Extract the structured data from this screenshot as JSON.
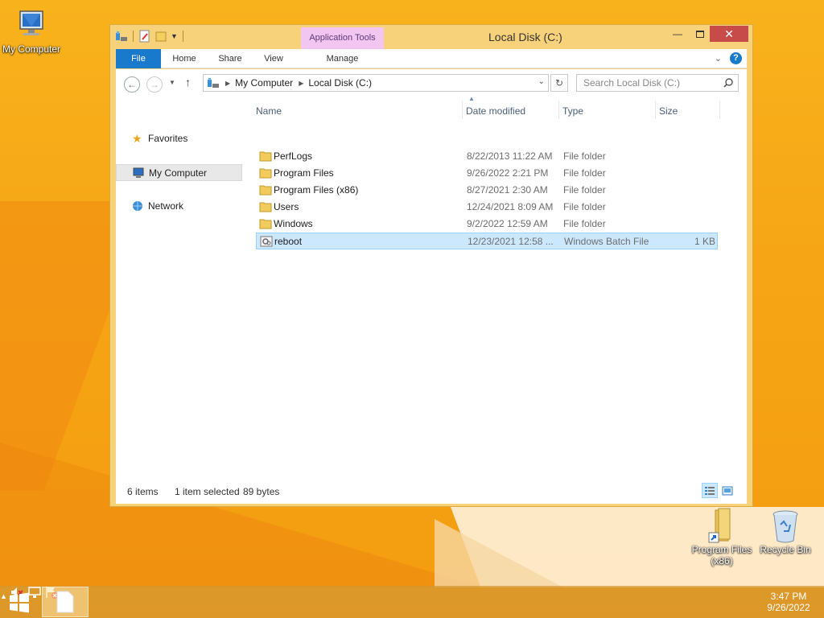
{
  "desktop": {
    "icons": [
      {
        "label": "My Computer",
        "icon": "computer-icon"
      },
      {
        "label": "Program Files (x86)",
        "icon": "folder-shortcut-icon"
      },
      {
        "label": "Recycle Bin",
        "icon": "recycle-bin-icon"
      }
    ]
  },
  "window": {
    "title": "Local Disk (C:)",
    "context_tab_group": "Application Tools",
    "ribbon_tabs": [
      "File",
      "Home",
      "Share",
      "View",
      "Manage"
    ],
    "address": {
      "crumbs": [
        "My Computer",
        "Local Disk (C:)"
      ]
    },
    "search": {
      "placeholder": "Search Local Disk (C:)"
    },
    "nav_pane": [
      {
        "label": "Favorites",
        "icon": "star-icon"
      },
      {
        "label": "My Computer",
        "icon": "computer-icon"
      },
      {
        "label": "Network",
        "icon": "network-icon"
      }
    ],
    "columns": [
      "Name",
      "Date modified",
      "Type",
      "Size"
    ],
    "files": [
      {
        "name": "PerfLogs",
        "date": "8/22/2013 11:22 AM",
        "type": "File folder",
        "size": "",
        "icon": "folder-icon"
      },
      {
        "name": "Program Files",
        "date": "9/26/2022 2:21 PM",
        "type": "File folder",
        "size": "",
        "icon": "folder-icon"
      },
      {
        "name": "Program Files (x86)",
        "date": "8/27/2021 2:30 AM",
        "type": "File folder",
        "size": "",
        "icon": "folder-icon"
      },
      {
        "name": "Users",
        "date": "12/24/2021 8:09 AM",
        "type": "File folder",
        "size": "",
        "icon": "folder-icon"
      },
      {
        "name": "Windows",
        "date": "9/2/2022 12:59 AM",
        "type": "File folder",
        "size": "",
        "icon": "folder-icon"
      },
      {
        "name": "reboot",
        "date": "12/23/2021 12:58 ...",
        "type": "Windows Batch File",
        "size": "1 KB",
        "icon": "batch-file-icon",
        "selected": true
      }
    ],
    "status": {
      "item_count": "6 items",
      "selection": "1 item selected",
      "selection_size": "89 bytes"
    }
  },
  "taskbar": {
    "time": "3:47 PM",
    "date": "9/26/2022"
  },
  "colors": {
    "accent": "#1979ca",
    "selection_bg": "#cce8ff",
    "selection_border": "#99d1ff",
    "window_frame": "#f7d27a",
    "close_button": "#c74b48",
    "context_tab": "#f2c6f0"
  }
}
